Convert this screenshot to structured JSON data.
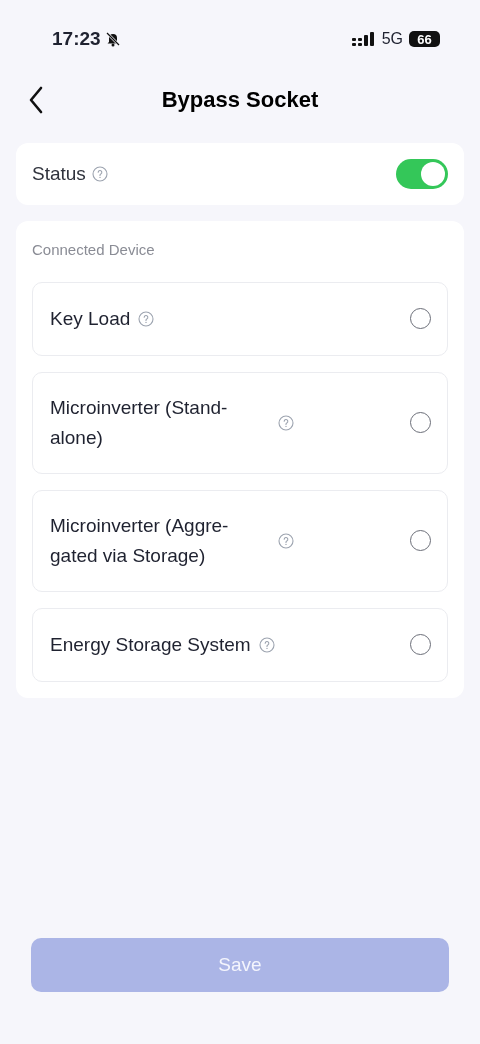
{
  "status_bar": {
    "time": "17:23",
    "network": "5G",
    "battery": "66"
  },
  "header": {
    "title": "Bypass Socket"
  },
  "status": {
    "label": "Status",
    "on": true
  },
  "connected_device": {
    "label": "Connected Device",
    "options": [
      {
        "label": "Key Load",
        "selected": false
      },
      {
        "label": "Microinverter (Stand-alone)",
        "selected": false
      },
      {
        "label": "Microinverter (Aggre-gated via Storage)",
        "selected": false
      },
      {
        "label": "Energy Storage System",
        "selected": false
      }
    ]
  },
  "save_button": {
    "label": "Save",
    "disabled": true
  }
}
